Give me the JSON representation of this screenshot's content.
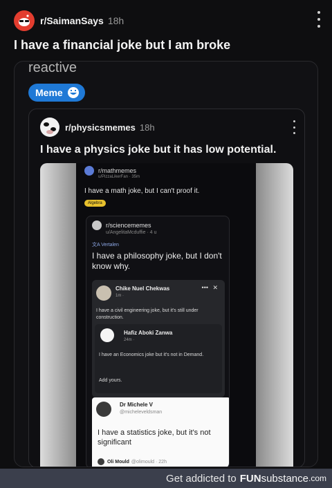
{
  "post": {
    "subreddit": "r/SaimanSays",
    "age": "18h",
    "title": "I have a financial joke but I am broke"
  },
  "crosspost1": {
    "overlay_text": "reactive",
    "flair": "Meme"
  },
  "crosspost2": {
    "subreddit": "r/physicsmemes",
    "age": "18h",
    "title": "I have a physics joke but it has low potential."
  },
  "image": {
    "mathmemes": {
      "subreddit": "r/mathmemes",
      "user": "u/PizzaLikerFan · 35m",
      "title": "I have a math joke, but I can't proof it.",
      "flair": "Algebra"
    },
    "sciencememes": {
      "subreddit": "r/sciencememes",
      "user": "u/AngelitaMcduffie · 4 u",
      "translate": "Vertalen",
      "title": "I have a philosophy joke, but I don't know why."
    },
    "facebook": {
      "name": "Chike Nuel Chekwas",
      "time": "1m ·",
      "text": "I have a civil engineering joke, but it's still under construction.",
      "reply": {
        "name": "Hafiz Aboki Zanwa",
        "time": "24m ·",
        "text": "I have an Economics joke but it's not in Demand.",
        "add": "Add yours."
      }
    },
    "tweet": {
      "name": "Dr Michele V",
      "handle": "@micheleveldsman",
      "text": "I have a statistics joke, but it's not significant",
      "bottom_name": "Oli Mould",
      "bottom_handle": "@olimould · 22h"
    }
  },
  "footer": {
    "prefix": "Get addicted to",
    "brand_bold": "FUN",
    "brand_rest": "substance",
    "tld": ".com"
  }
}
